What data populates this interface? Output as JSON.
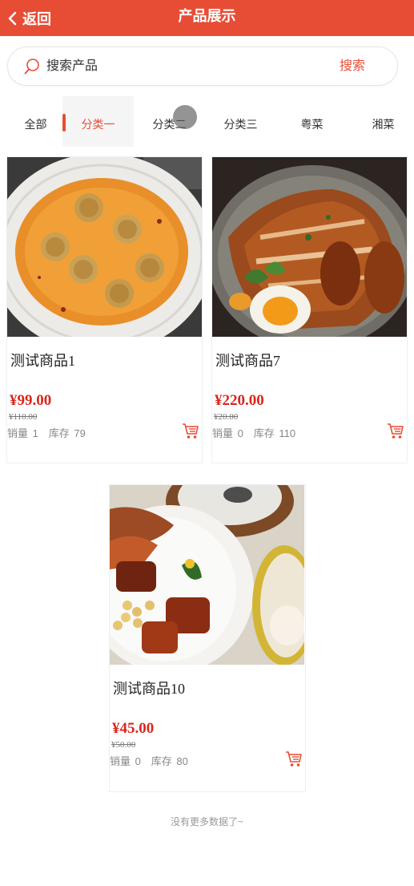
{
  "header": {
    "back_label": "返回",
    "title": "产品展示",
    "background": "#e74d35"
  },
  "search": {
    "placeholder": "搜索产品",
    "button_label": "搜索"
  },
  "tabs": [
    {
      "label": "全部",
      "active": false
    },
    {
      "label": "分类一",
      "active": true
    },
    {
      "label": "分类二",
      "active": false
    },
    {
      "label": "分类三",
      "active": false
    },
    {
      "label": "粤菜",
      "active": false
    },
    {
      "label": "湘菜",
      "active": false
    }
  ],
  "products": [
    {
      "name": "测试商品1",
      "price": "¥99.00",
      "old_price": "¥110.00",
      "sales_label": "销量",
      "sales": "1",
      "stock_label": "库存",
      "stock": "79",
      "image": "fried-dumplings-in-sauce"
    },
    {
      "name": "测试商品7",
      "price": "¥220.00",
      "old_price": "¥20.00",
      "sales_label": "销量",
      "sales": "0",
      "stock_label": "库存",
      "stock": "110",
      "image": "roast-chicken-with-egg"
    },
    {
      "name": "测试商品10",
      "price": "¥45.00",
      "old_price": "¥50.00",
      "sales_label": "销量",
      "sales": "0",
      "stock_label": "库存",
      "stock": "80",
      "image": "pork-beans-dim-sum"
    }
  ],
  "footer": {
    "no_more_text": "没有更多数据了~"
  },
  "colors": {
    "accent": "#e74d35",
    "price": "#d9261c"
  },
  "icons": [
    "back-arrow-icon",
    "search-icon",
    "cart-icon"
  ]
}
